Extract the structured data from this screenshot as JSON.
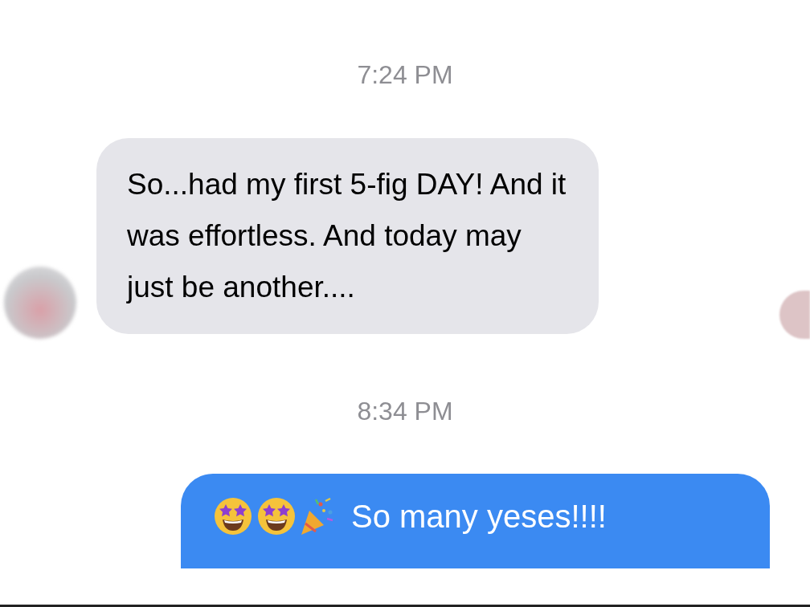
{
  "messages": [
    {
      "kind": "timestamp",
      "text": "7:24 PM"
    },
    {
      "kind": "incoming",
      "text": "So...had my first 5-fig DAY! And it was effortless. And today may just be another...."
    },
    {
      "kind": "timestamp",
      "text": "8:34 PM"
    },
    {
      "kind": "outgoing",
      "text": "So many yeses!!!!"
    }
  ]
}
